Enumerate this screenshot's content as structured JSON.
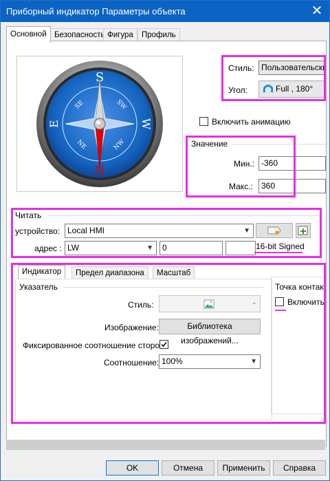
{
  "window": {
    "title": "Приборный индикатор Параметры объекта"
  },
  "tabs": [
    "Основной",
    "Безопасность",
    "Фигура",
    "Профиль"
  ],
  "style_section": {
    "style_label": "Стиль:",
    "style_value": "Пользовательски",
    "angle_label": "Угол:",
    "angle_value": "Full , 180°"
  },
  "animation": {
    "label": "Включить анимацию",
    "checked": false
  },
  "value_group": {
    "title": "Значение",
    "min_label": "Мин.:",
    "min_value": "-360",
    "max_label": "Макс.:",
    "max_value": "360"
  },
  "read_group": {
    "title": "Читать",
    "device_label": "устройство:",
    "device_value": "Local HMI",
    "address_label": "адрес :",
    "address_type": "LW",
    "address_value": "0",
    "address_extra": "",
    "data_format": "16-bit Signed"
  },
  "inner_tabs": [
    "Индикатор",
    "Предел диапазона",
    "Масштаб"
  ],
  "pointer_group": {
    "title": "Указатель",
    "style_label": "Стиль:",
    "image_label": "Изображение:",
    "image_button": "Библиотека изображений...",
    "aspect_label": "Фиксированное соотношение сторон:",
    "aspect_checked": true,
    "ratio_label": "Соотношение:",
    "ratio_value": "100%"
  },
  "center_group": {
    "title": "Точка контак",
    "enable_label": "Включить",
    "enable_checked": false
  },
  "buttons": {
    "ok": "OK",
    "cancel": "Отмена",
    "apply": "Применить",
    "help": "Справка"
  },
  "icons": [
    "close-icon",
    "compass-dial-image",
    "gauge-style-icon",
    "tag-icon",
    "add-tag-icon",
    "picture-icon",
    "checkmark-icon",
    "chevron-down-icon"
  ],
  "colors": {
    "titlebar": "#0b64c4",
    "highlight": "#e62ee6",
    "dial_blue": "#1565c0",
    "needle_red": "#e00000"
  }
}
